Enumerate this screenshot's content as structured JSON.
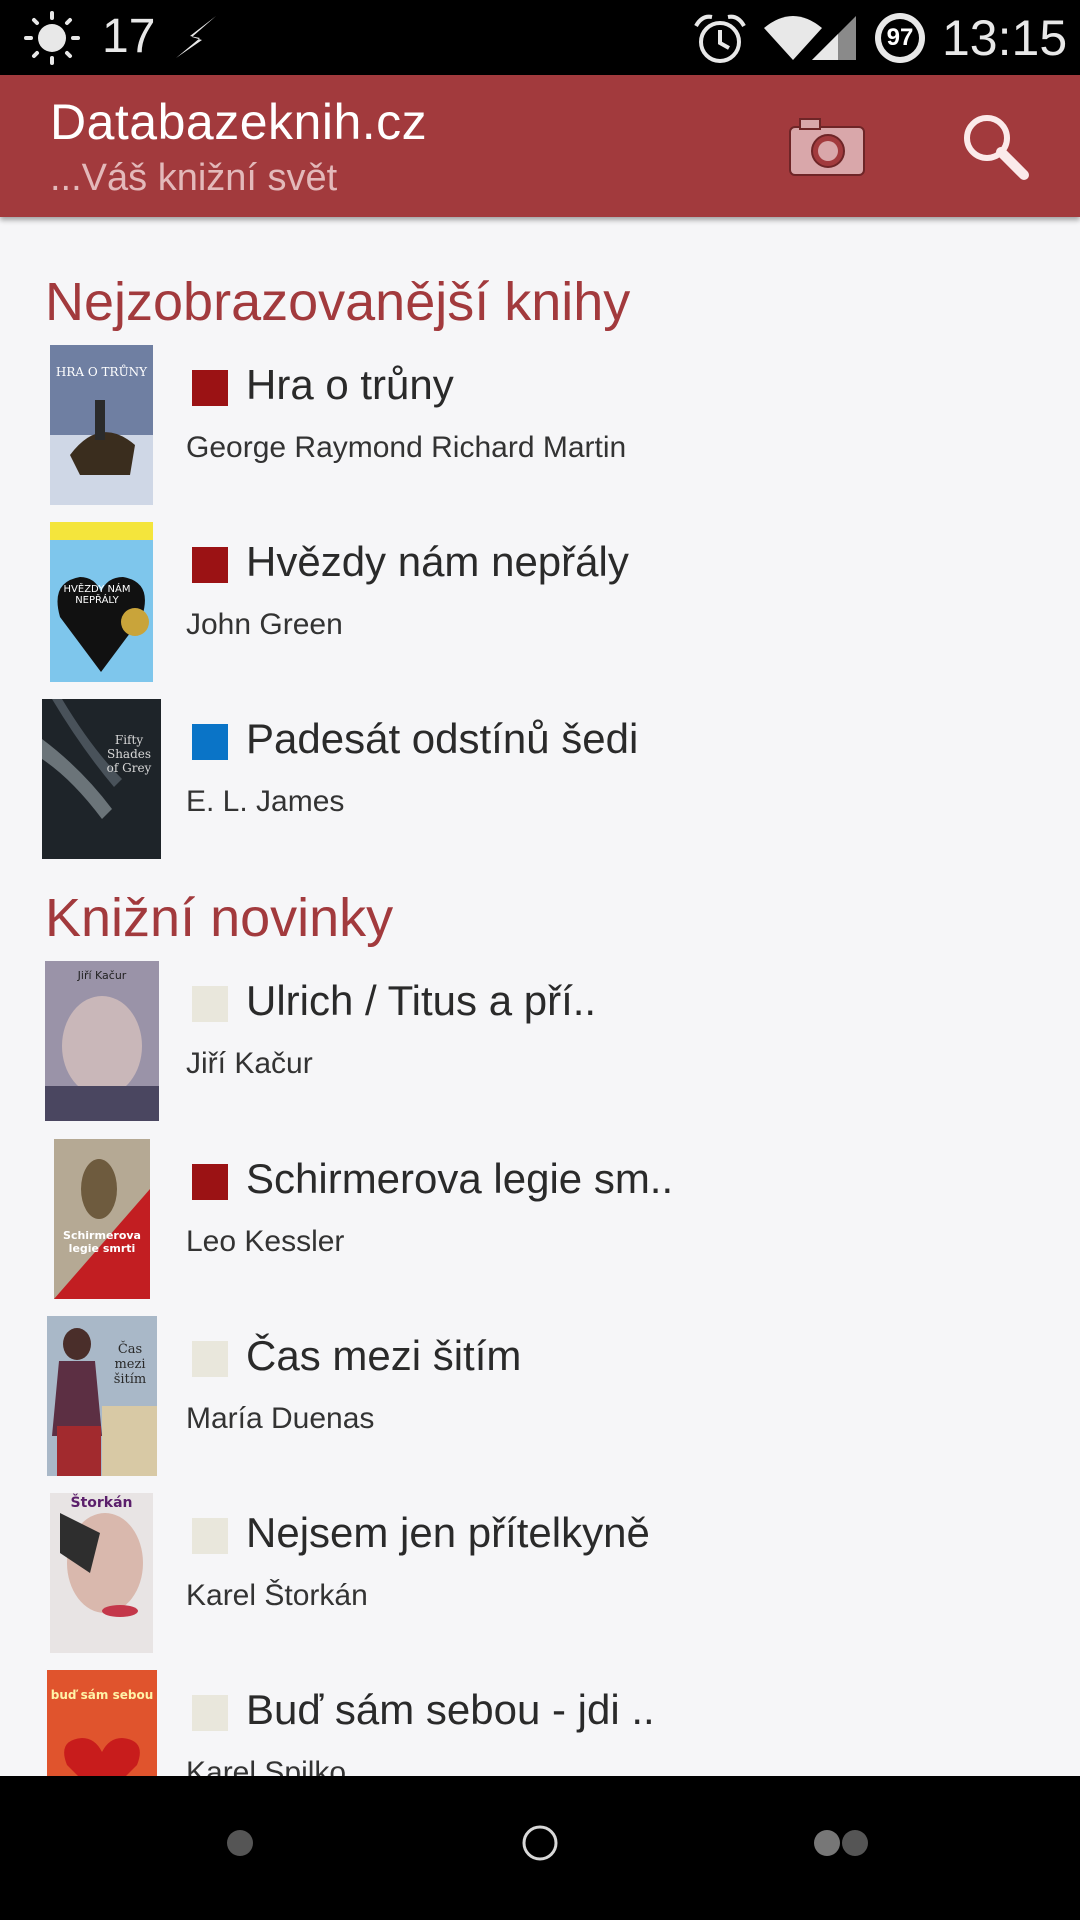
{
  "status_bar": {
    "temperature": "17",
    "battery": "97",
    "time": "13:15",
    "icons": [
      "weather-sun-icon",
      "flash-icon",
      "alarm-icon",
      "wifi-icon",
      "signal-icon",
      "battery-icon"
    ]
  },
  "app_bar": {
    "title": "Databazeknih.cz",
    "subtitle": "...Váš knižní svět",
    "actions": [
      "camera-icon",
      "search-icon"
    ],
    "background_color": "#a23a3d"
  },
  "sections": [
    {
      "title": "Nejzobrazovanější knihy",
      "books": [
        {
          "title": "Hra o trůny",
          "author": "George Raymond Richard Martin",
          "status_color": "#9b1214",
          "cover_text": "HRA O TRŮNY"
        },
        {
          "title": "Hvězdy nám nepřály",
          "author": "John Green",
          "status_color": "#9b1214",
          "cover_text": "HVĚZDY NÁM NEPŘÁLY"
        },
        {
          "title": "Padesát odstínů šedi",
          "author": "E. L. James",
          "status_color": "#0a74c7",
          "cover_text": "Fifty Shades of Grey"
        }
      ]
    },
    {
      "title": "Knižní novinky",
      "books": [
        {
          "title": "Ulrich / Titus a pří..",
          "author": "Jiří Kačur",
          "status_color": "#e9e7dc",
          "cover_text": "Jiří Kačur"
        },
        {
          "title": "Schirmerova legie sm..",
          "author": "Leo Kessler",
          "status_color": "#9b1214",
          "cover_text": "Schirmerova legie smrti"
        },
        {
          "title": "Čas mezi šitím",
          "author": "María Duenas",
          "status_color": "#e9e7dc",
          "cover_text": "Čas mezi šitím"
        },
        {
          "title": "Nejsem jen přítelkyně",
          "author": "Karel Štorkán",
          "status_color": "#e9e7dc",
          "cover_text": "Štorkán"
        },
        {
          "title": "Buď sám sebou - jdi ..",
          "author": "Karel Spilko",
          "status_color": "#e9e7dc",
          "cover_text": "buď sám sebou"
        }
      ]
    }
  ],
  "nav_bar": {
    "buttons": [
      "back-button",
      "home-button",
      "recents-button"
    ]
  }
}
